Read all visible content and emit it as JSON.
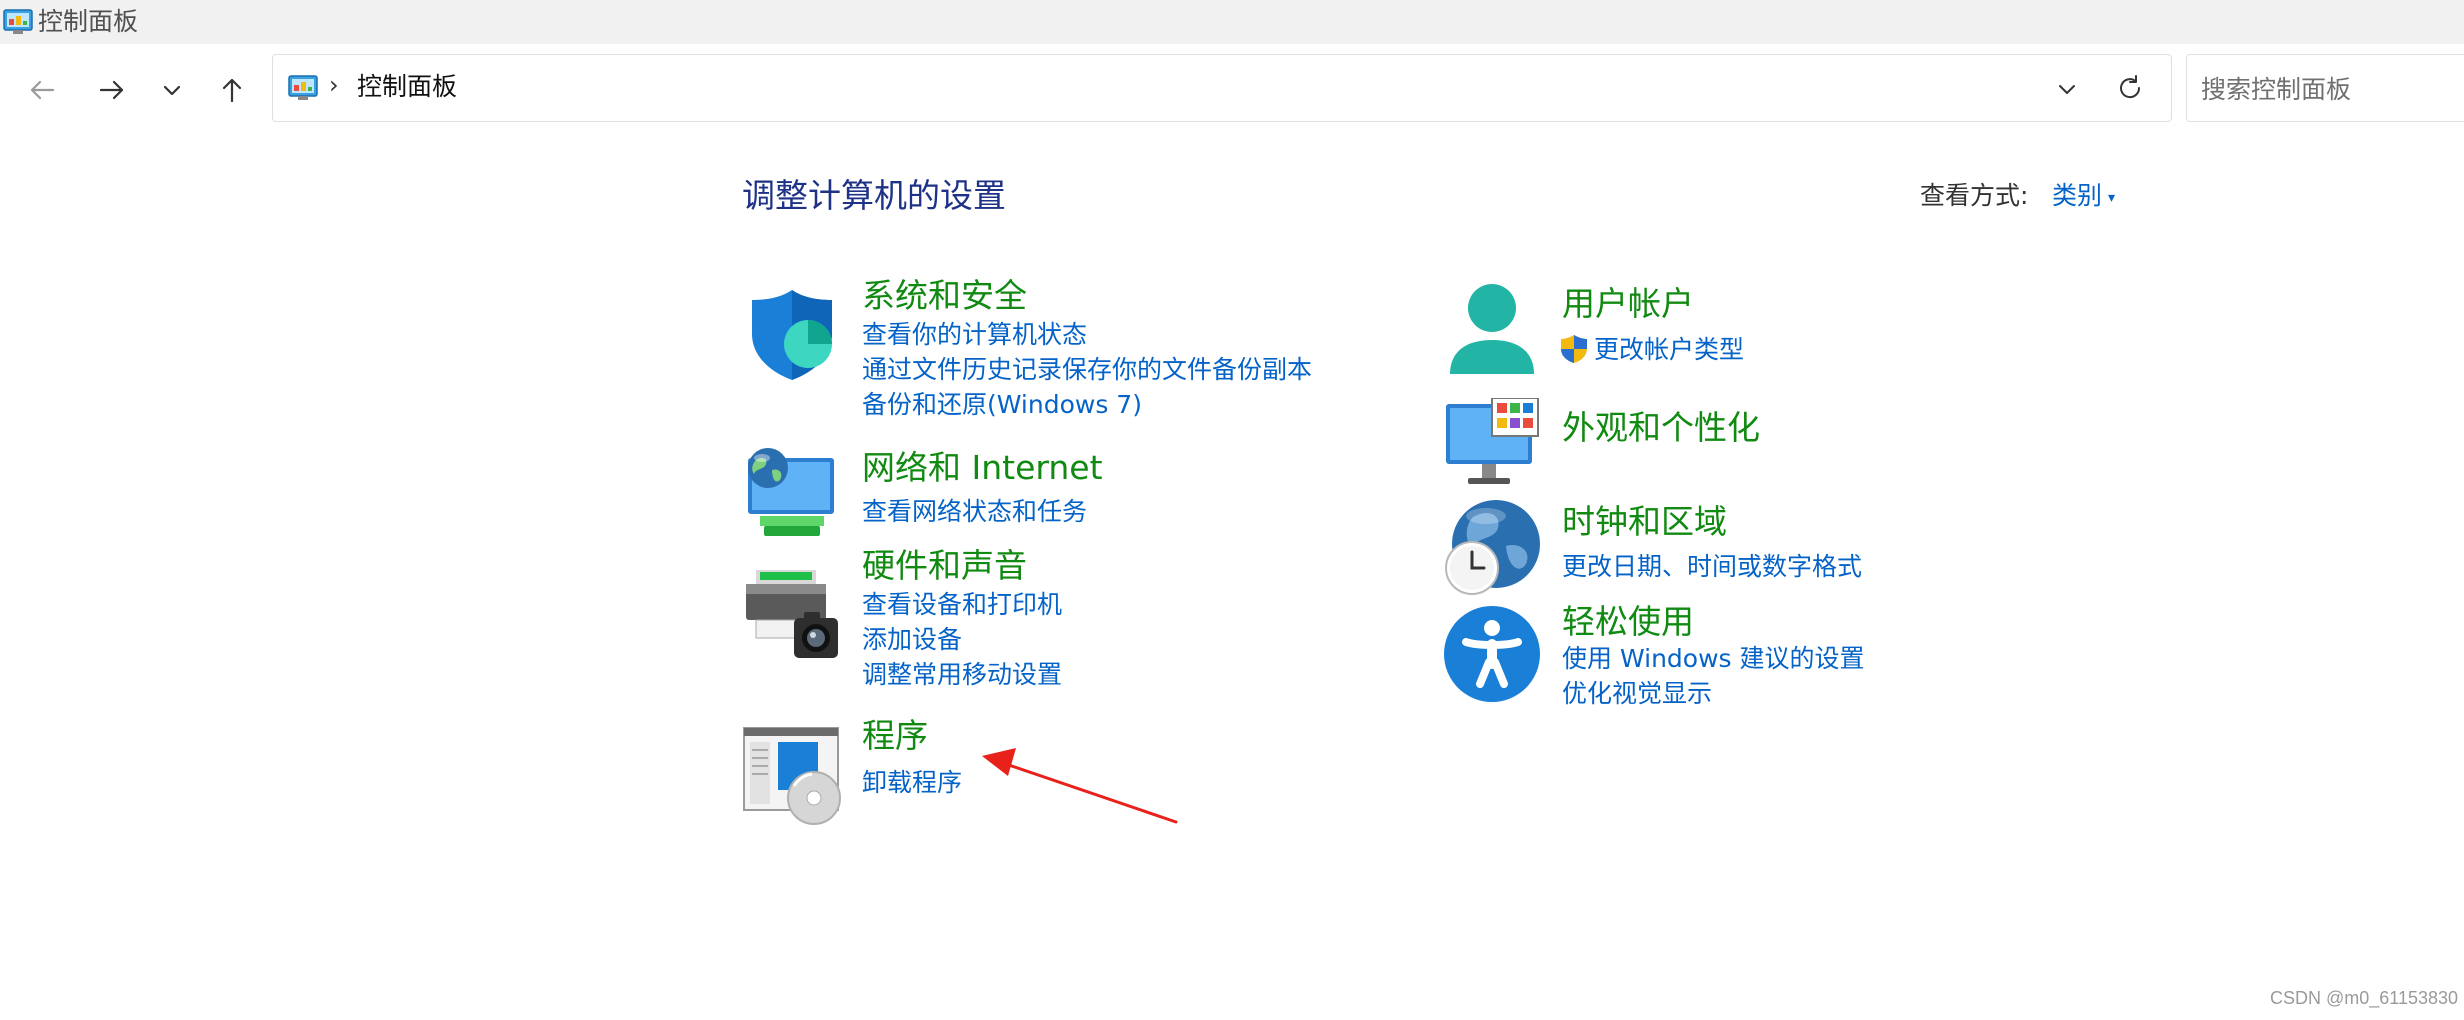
{
  "window": {
    "title": "控制面板"
  },
  "address": {
    "separator": "›",
    "path": "控制面板"
  },
  "search": {
    "placeholder": "搜索控制面板"
  },
  "content": {
    "heading": "调整计算机的设置",
    "view_by_label": "查看方式:",
    "view_by_value": "类别",
    "view_by_caret": "▾"
  },
  "categories": [
    {
      "title": "系统和安全",
      "icon": "shield-icon",
      "links": [
        "查看你的计算机状态",
        "通过文件历史记录保存你的文件备份副本",
        "备份和还原(Windows 7)"
      ]
    },
    {
      "title": "网络和 Internet",
      "icon": "network-globe-icon",
      "links": [
        "查看网络状态和任务"
      ]
    },
    {
      "title": "硬件和声音",
      "icon": "printer-camera-icon",
      "links": [
        "查看设备和打印机",
        "添加设备",
        "调整常用移动设置"
      ]
    },
    {
      "title": "程序",
      "icon": "programs-disc-icon",
      "links": [
        "卸载程序"
      ]
    },
    {
      "title": "用户帐户",
      "icon": "user-icon",
      "links": [
        "更改帐户类型"
      ]
    },
    {
      "title": "外观和个性化",
      "icon": "monitor-icon",
      "links": []
    },
    {
      "title": "时钟和区域",
      "icon": "clock-globe-icon",
      "links": [
        "更改日期、时间或数字格式"
      ]
    },
    {
      "title": "轻松使用",
      "icon": "accessibility-icon",
      "links": [
        "使用 Windows 建议的设置",
        "优化视觉显示"
      ]
    }
  ],
  "watermark": "CSDN @m0_61153830",
  "colors": {
    "category_title": "#118a11",
    "link": "#0563c8",
    "heading": "#1e3287",
    "annotation_arrow": "#e8211b"
  }
}
